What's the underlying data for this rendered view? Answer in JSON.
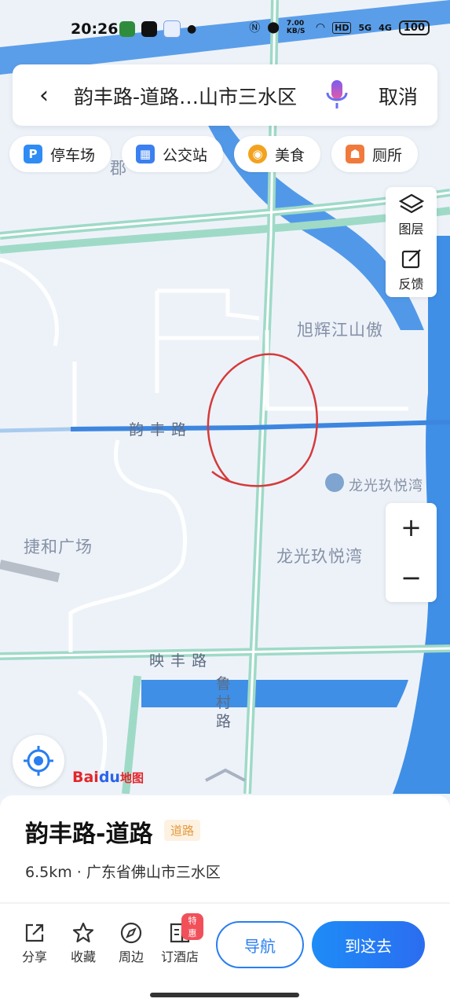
{
  "status_bar": {
    "time": "20:26",
    "net_speed": "7.00 KB/S",
    "hd_label": "HD",
    "signal_5g": "5G",
    "signal_4g": "4G",
    "battery": "100"
  },
  "search_bar": {
    "query": "韵丰路-道路…山市三水区",
    "cancel_label": "取消"
  },
  "chips": [
    {
      "label": "停车场",
      "icon": "parking-icon",
      "icon_glyph": "P",
      "color": "#2f8cf4"
    },
    {
      "label": "公交站",
      "icon": "bus-stop-icon",
      "icon_glyph": "▦",
      "color": "#3b7ff0"
    },
    {
      "label": "美食",
      "icon": "food-icon",
      "icon_glyph": "◉",
      "color": "#f3a21f"
    },
    {
      "label": "厕所",
      "icon": "toilet-icon",
      "icon_glyph": "☗",
      "color": "#f07a3c"
    }
  ],
  "side_tools": {
    "layers_label": "图层",
    "feedback_label": "反馈"
  },
  "map_labels": {
    "district_partial": "郡",
    "xuhui": "旭辉江山傲",
    "yunfeng_road": "韵 丰 路",
    "longguang_poi": "龙光玖悦湾",
    "jiehe": "捷和广场",
    "longguang": "龙光玖悦湾",
    "yingfeng_road": "映 丰 路",
    "lucun_road": "鲁村路"
  },
  "zoom": {
    "in": "+",
    "out": "−"
  },
  "logo": {
    "bai": "Bai",
    "du": "du",
    "map": "地图"
  },
  "place_card": {
    "title": "韵丰路-道路",
    "badge": "道路",
    "subtitle": "6.5km · 广东省佛山市三水区"
  },
  "actions": [
    {
      "label": "分享",
      "icon": "share-icon"
    },
    {
      "label": "收藏",
      "icon": "star-icon"
    },
    {
      "label": "周边",
      "icon": "compass-icon"
    },
    {
      "label": "订酒店",
      "icon": "hotel-icon",
      "tag": "特惠"
    }
  ],
  "nav_button": "导航",
  "go_button": "到这去",
  "colors": {
    "accent": "#2a7ef0",
    "highlight_road": "#3d86e0",
    "annotation_circle": "#d63a3a",
    "water": "#3f8fe6"
  }
}
